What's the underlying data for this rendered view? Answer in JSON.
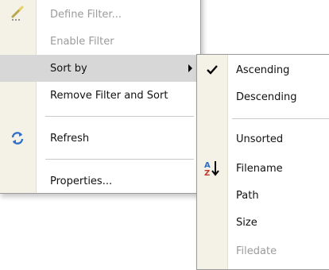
{
  "main_menu": {
    "items": [
      {
        "label": "Define Filter...",
        "state": "disabled",
        "icon": "define-filter-icon"
      },
      {
        "label": "Enable Filter",
        "state": "disabled"
      },
      {
        "label": "Sort by",
        "state": "highlighted",
        "has_submenu": true
      },
      {
        "label": "Remove Filter and Sort",
        "state": "enabled"
      },
      {
        "label": "Refresh",
        "state": "enabled",
        "icon": "refresh-icon"
      },
      {
        "label": "Properties...",
        "state": "enabled"
      }
    ]
  },
  "sort_submenu": {
    "items": [
      {
        "label": "Ascending",
        "checked": true,
        "icon": "checkmark-icon"
      },
      {
        "label": "Descending"
      },
      {
        "label": "Unsorted"
      },
      {
        "label": "Filename",
        "icon": "sort-az-icon"
      },
      {
        "label": "Path"
      },
      {
        "label": "Size"
      },
      {
        "label": "Filedate"
      }
    ]
  },
  "colors": {
    "highlight": "#d7d7d7",
    "gutter": "#f4f2e6",
    "disabled_text": "#9b9b9b",
    "refresh_icon": "#2f6fc7"
  }
}
